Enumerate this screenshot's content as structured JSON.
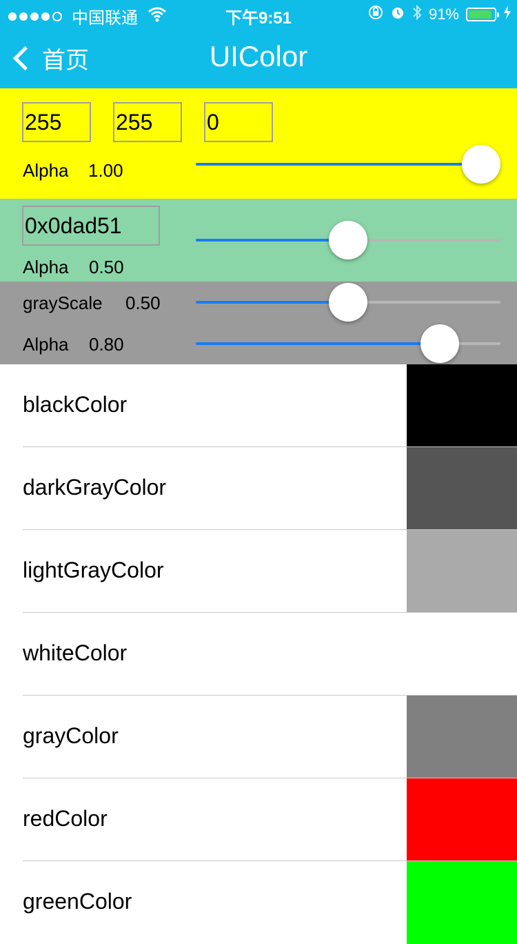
{
  "status_bar": {
    "carrier": "中国联通",
    "time": "下午9:51",
    "battery_percent": "91%",
    "battery_level": 0.91
  },
  "nav": {
    "back_label": "首页",
    "title": "UIColor"
  },
  "rgb_panel": {
    "background": "#ffff00",
    "red": "255",
    "green": "255",
    "blue": "0",
    "alpha_label": "Alpha",
    "alpha_value": "1.00",
    "alpha_level": 1.0
  },
  "hex_panel": {
    "background": "#8ad6a8",
    "hex_value": "0x0dad51",
    "alpha_label": "Alpha",
    "alpha_value": "0.50",
    "alpha_level": 0.5
  },
  "gray_panel": {
    "background": "#9b9b9b",
    "grayscale_label": "grayScale",
    "grayscale_value": "0.50",
    "grayscale_level": 0.5,
    "alpha_label": "Alpha",
    "alpha_value": "0.80",
    "alpha_level": 0.8
  },
  "colors": [
    {
      "name": "blackColor",
      "color": "#000000"
    },
    {
      "name": "darkGrayColor",
      "color": "#555555"
    },
    {
      "name": "lightGrayColor",
      "color": "#aaaaaa"
    },
    {
      "name": "whiteColor",
      "color": "#ffffff"
    },
    {
      "name": "grayColor",
      "color": "#808080"
    },
    {
      "name": "redColor",
      "color": "#ff0000"
    },
    {
      "name": "greenColor",
      "color": "#00ff00"
    }
  ],
  "accent_color": "#10bde9",
  "slider_color": "#1a7cf2"
}
